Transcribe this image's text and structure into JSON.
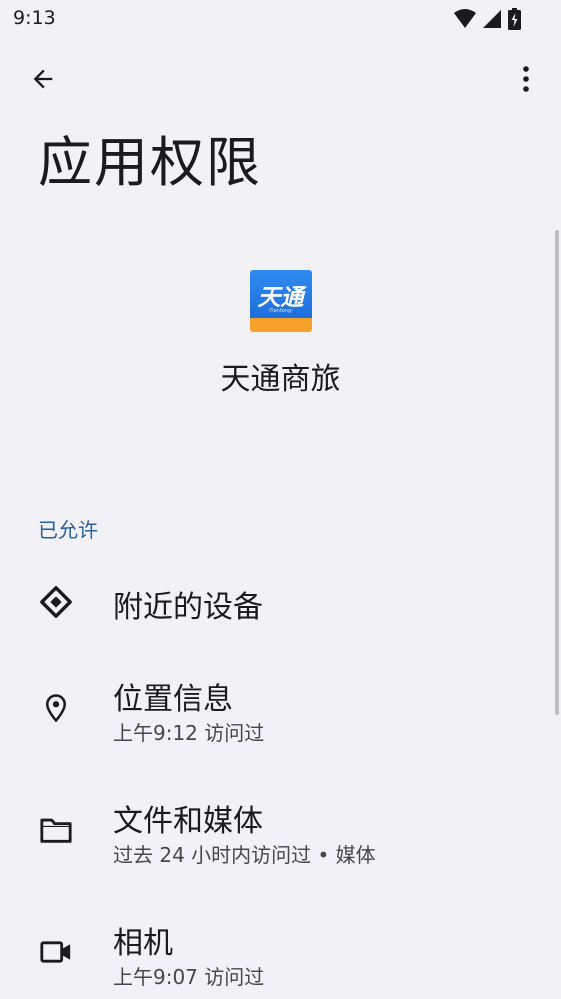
{
  "status_bar": {
    "time": "9:13",
    "icons": [
      "wifi-icon",
      "cell-signal-icon",
      "battery-charging-icon"
    ]
  },
  "toolbar": {
    "back_icon": "arrow-back-icon",
    "more_icon": "more-vert-icon"
  },
  "page": {
    "title": "应用权限"
  },
  "app": {
    "name": "天通商旅",
    "icon_text": "天通",
    "icon_subtext": "-Tiantong-",
    "icon_colors": {
      "top": "#2f8bf0",
      "bottom": "#f6a12a"
    }
  },
  "sections": [
    {
      "header": "已允许",
      "accent": "#2a5f9e",
      "items": [
        {
          "icon": "nearby-devices-icon",
          "title": "附近的设备",
          "subtitle": ""
        },
        {
          "icon": "location-pin-icon",
          "title": "位置信息",
          "subtitle": "上午9:12 访问过"
        },
        {
          "icon": "folder-icon",
          "title": "文件和媒体",
          "subtitle": "过去 24 小时内访问过 • 媒体"
        },
        {
          "icon": "videocam-icon",
          "title": "相机",
          "subtitle": "上午9:07 访问过"
        }
      ]
    }
  ]
}
